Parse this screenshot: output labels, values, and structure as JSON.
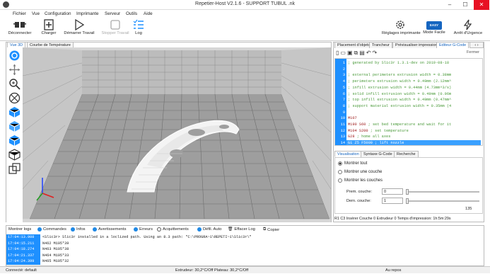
{
  "window": {
    "title": "Repetier-Host V2.1.6 - SUPPORT TUBUL .nk",
    "minimize": "–",
    "maximize": "☐",
    "close": "✕"
  },
  "menu": [
    "Fichier",
    "Vue",
    "Configuration",
    "Imprimante",
    "Serveur",
    "Outils",
    "Aide"
  ],
  "toolbar": {
    "disconnect": "Déconnecter",
    "load": "Charger",
    "start": "Démarrer Travail",
    "stop": "Stopper Travail",
    "log": "Log",
    "printer_settings": "Réglages imprimante",
    "easy_mode": "Mode Facile",
    "easy_badge": "EASY",
    "emergency": "Arrêt d'Urgence"
  },
  "left_tabs": [
    "Vue 3D",
    "Courbe de Température"
  ],
  "right_tabs": [
    "Placement d'objets",
    "Trancheur",
    "Prévisualiser impression",
    "Editeur G-Code"
  ],
  "gcode": {
    "close_label": "Fermer",
    "lines": [
      {
        "n": "1",
        "t": "; generated by Slic3r 1.3.1-dev on 2019-08-18",
        "k": "cm"
      },
      {
        "n": "2",
        "t": "",
        "k": ""
      },
      {
        "n": "3",
        "t": "; external perimeters extrusion width = 0.38mm",
        "k": "cm"
      },
      {
        "n": "4",
        "t": "; perimeters extrusion width = 0.49mm (2.12mm^",
        "k": "cm"
      },
      {
        "n": "5",
        "t": "; infill extrusion width = 0.44mm (4.73mm^3/s)",
        "k": "cm"
      },
      {
        "n": "6",
        "t": "; solid infill extrusion width = 0.49mm (0.96m",
        "k": "cm"
      },
      {
        "n": "7",
        "t": "; top infill extrusion width = 0.49mm (0.47mm^",
        "k": "cm"
      },
      {
        "n": "8",
        "t": "; support material extrusion width = 0.35mm (4",
        "k": "cm"
      },
      {
        "n": "9",
        "t": "",
        "k": ""
      },
      {
        "n": "10",
        "t": "M107",
        "k": "kw"
      },
      {
        "n": "11",
        "t": "M190 S60 ; set bed temperature and wait for it",
        "k": "mix"
      },
      {
        "n": "12",
        "t": "M104 S200 ; set temperature",
        "k": "mix"
      },
      {
        "n": "13",
        "t": "G28 ; home all axes",
        "k": "mix"
      },
      {
        "n": "14",
        "t": "G1 Z5 F5000 ; lift nozzle",
        "k": "hl"
      }
    ]
  },
  "vis_tabs": [
    "Visualisation",
    "Syntaxe G-Code",
    "Recherche"
  ],
  "visualisation": {
    "show_all": "Montrer tout",
    "show_one": "Montrer une couche",
    "show_layers": "Montrer les couches",
    "first_layer_label": "Prem. couche:",
    "first_layer_value": "0",
    "last_layer_label": "Dern. couche:",
    "last_layer_value": "1",
    "max_layer": "135"
  },
  "status_line": "R1  C3  Insérer  Couche 0  Extrudeur 0  Temps d'impression: 1h:5m:29s",
  "log": {
    "tab": "Montrer logs",
    "filters": [
      {
        "label": "Commandes",
        "on": true
      },
      {
        "label": "Infos",
        "on": true
      },
      {
        "label": "Avertissements",
        "on": true
      },
      {
        "label": "Erreurs",
        "on": true
      },
      {
        "label": "Acquittements",
        "on": false
      },
      {
        "label": "Défil. Auto",
        "on": true
      }
    ],
    "clear": "Effacer Log",
    "copy": "Copier",
    "rows": [
      {
        "ts": "17:04:13.908",
        "tx": "<Slic3r> Slic3r installed in a loclized path. Using an 8.3 path: \"C:\\PROGRA~1\\REPETI~1\\Slic3r\\\""
      },
      {
        "ts": "17:04:15.211",
        "tx": "N462 M105*39"
      },
      {
        "ts": "17:04:18.274",
        "tx": "N463 M105*38"
      },
      {
        "ts": "17:04:21.337",
        "tx": "N464 M105*33"
      },
      {
        "ts": "17:04:24.399",
        "tx": "N465 M105*32"
      }
    ]
  },
  "statusbar": {
    "left": "Connecté: default",
    "center": "Extrudeur: 30,2°C/Off Plateau: 30,2°C/Off",
    "right": "Au repos"
  },
  "colors": {
    "accent": "#1e90ff",
    "easy": "#1565c0",
    "viewport_bg": "#d8d8d8"
  }
}
